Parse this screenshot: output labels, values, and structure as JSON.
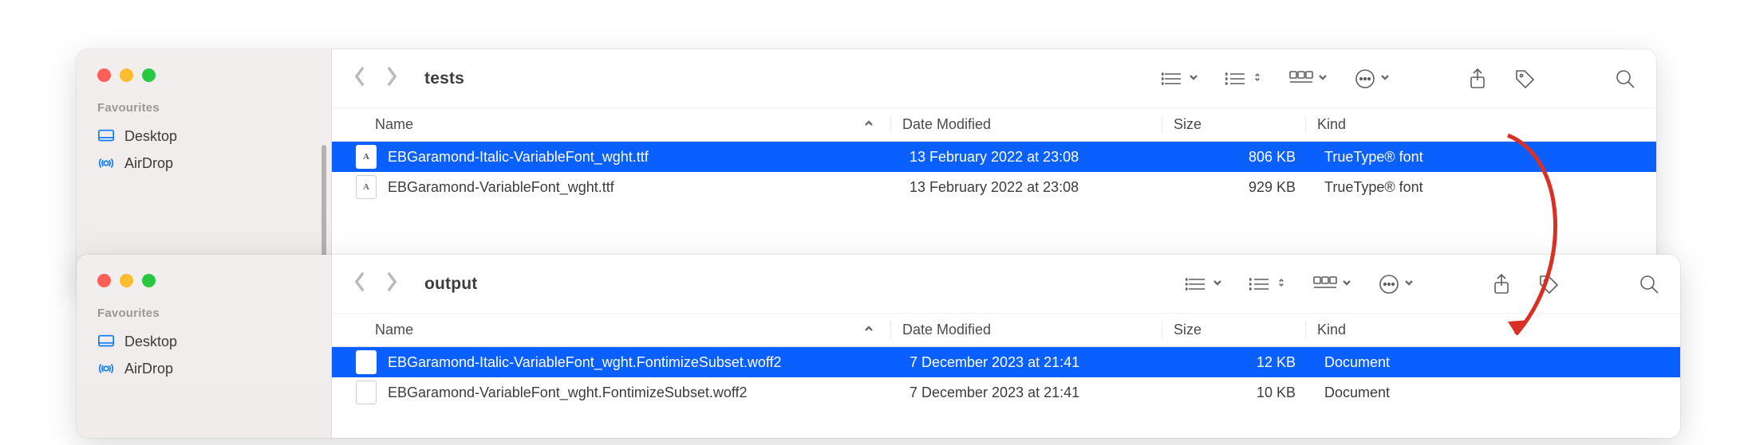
{
  "window1": {
    "traffic": true,
    "sidebar": {
      "heading": "Favourites",
      "items": [
        {
          "icon": "desktop-icon",
          "label": "Desktop"
        },
        {
          "icon": "airdrop-icon",
          "label": "AirDrop"
        }
      ]
    },
    "toolbar": {
      "title": "tests"
    },
    "columns": {
      "c1": "Name",
      "c2": "Date Modified",
      "c3": "Size",
      "c4": "Kind"
    },
    "rows": [
      {
        "name": "EBGaramond-Italic-VariableFont_wght.ttf",
        "date": "13 February 2022 at 23:08",
        "size": "806 KB",
        "kind": "TrueType® font",
        "selected": true,
        "icon": "font"
      },
      {
        "name": "EBGaramond-VariableFont_wght.ttf",
        "date": "13 February 2022 at 23:08",
        "size": "929 KB",
        "kind": "TrueType® font",
        "selected": false,
        "icon": "font"
      }
    ]
  },
  "window2": {
    "traffic": true,
    "sidebar": {
      "heading": "Favourites",
      "items": [
        {
          "icon": "desktop-icon",
          "label": "Desktop"
        },
        {
          "icon": "airdrop-icon",
          "label": "AirDrop"
        }
      ]
    },
    "toolbar": {
      "title": "output"
    },
    "columns": {
      "c1": "Name",
      "c2": "Date Modified",
      "c3": "Size",
      "c4": "Kind"
    },
    "rows": [
      {
        "name": "EBGaramond-Italic-VariableFont_wght.FontimizeSubset.woff2",
        "date": "7 December 2023 at 21:41",
        "size": "12 KB",
        "kind": "Document",
        "selected": true,
        "icon": "doc"
      },
      {
        "name": "EBGaramond-VariableFont_wght.FontimizeSubset.woff2",
        "date": "7 December 2023 at 21:41",
        "size": "10 KB",
        "kind": "Document",
        "selected": false,
        "icon": "doc"
      }
    ]
  }
}
